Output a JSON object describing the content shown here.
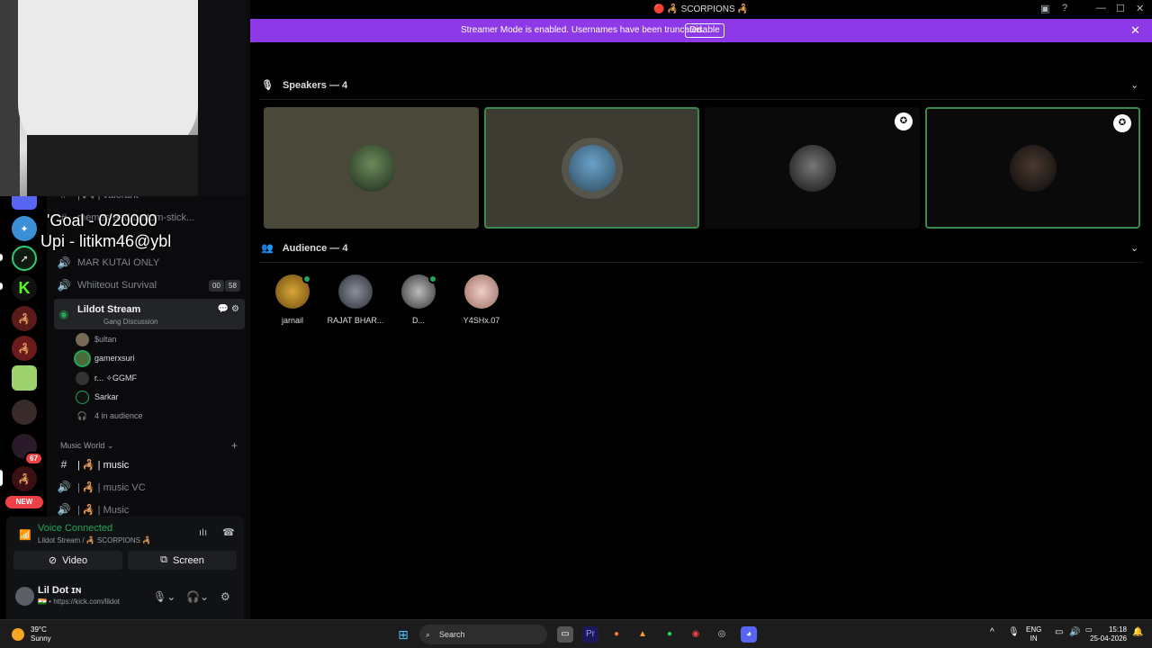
{
  "window": {
    "title": "🔴 🦂 SCORPIONS 🦂"
  },
  "banner": {
    "text": "Streamer Mode is enabled. Usernames have been truncated.",
    "button": "Disable"
  },
  "overlay": {
    "goal": "'Goal - 0/20000",
    "upi": "Upi - litikm46@ybl"
  },
  "sidebar": {
    "channels": [
      {
        "label": "| 🎮 | valorant"
      },
      {
        "label": "memes-and-bottom-stick..."
      },
      {
        "label": "MAR KUTAI ONLY"
      },
      {
        "label": "Whiiteout Survival",
        "counts": [
          "00",
          "58"
        ]
      }
    ],
    "active_channel": {
      "label": "Lildot Stream",
      "sub": "Gang Discussion"
    },
    "voice_users": [
      "$ultan",
      "gamerxsuri",
      "r... ✧GGMF",
      "Sarkar"
    ],
    "audience_count": "4 in audience",
    "category": "Music World",
    "music_channels": [
      "| 🦂 | music",
      "| 🦂 | music VC",
      "| 🦂 | Music"
    ]
  },
  "rail": {
    "badge": "67",
    "new_tag": "NEW"
  },
  "voice": {
    "status": "Voice Connected",
    "location": "Lildot Stream / 🦂 SCORPIONS 🦂",
    "video_label": "Video",
    "screen_label": "Screen"
  },
  "user": {
    "name": "Lil Dot ɪɴ",
    "link": "🇮🇳 • https://kick.com/lildot"
  },
  "stage": {
    "speakers_header": "Speakers — 4",
    "audience_header": "Audience — 4",
    "audience": [
      "jarnail",
      "RAJAT BHAR...",
      "D...",
      "Y4SHx.07"
    ]
  },
  "taskbar": {
    "weather_temp": "39°C",
    "weather_desc": "Sunny",
    "search": "Search",
    "lang": "ENG",
    "region": "IN",
    "time": "15:18",
    "date": "25-04-2026"
  },
  "colors": {
    "banner": "#8d39e8",
    "voice_green": "#23a55a",
    "speaking_border": "#3a8a4d"
  }
}
